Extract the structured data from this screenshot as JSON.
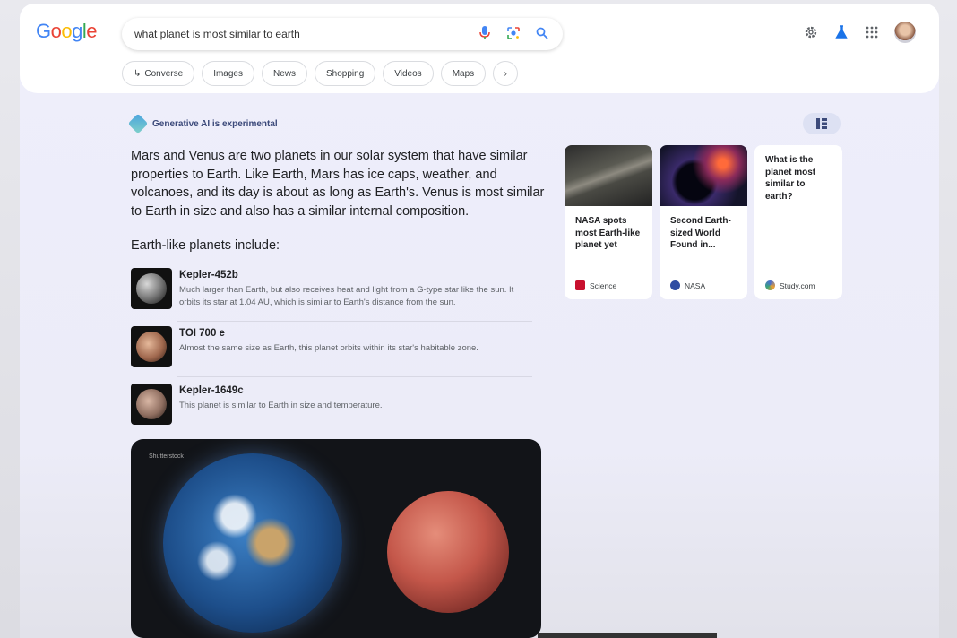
{
  "search": {
    "query": "what planet is most similar to earth"
  },
  "logo": {
    "text": "Google"
  },
  "chips": [
    {
      "label": "Converse",
      "icon": "converse-arrow-icon"
    },
    {
      "label": "Images"
    },
    {
      "label": "News"
    },
    {
      "label": "Shopping"
    },
    {
      "label": "Videos"
    },
    {
      "label": "Maps"
    }
  ],
  "ai": {
    "label": "Generative AI is experimental",
    "summary": "Mars and Venus are two planets in our solar system that have similar properties to Earth. Like Earth, Mars has ice caps, weather, and volcanoes, and its day is about as long as Earth's. Venus is most similar to Earth in size and also has a similar internal composition.",
    "subhead": "Earth-like planets include:",
    "planets": [
      {
        "name": "Kepler-452b",
        "desc": "Much larger than Earth, but also receives heat and light from a G-type star like the sun. It orbits its star at 1.04 AU, which is similar to Earth's distance from the sun."
      },
      {
        "name": "TOI 700 e",
        "desc": "Almost the same size as Earth, this planet orbits within its star's habitable zone."
      },
      {
        "name": "Kepler-1649c",
        "desc": "This planet is similar to Earth in size and temperature."
      }
    ],
    "hero_credit": "Shutterstock"
  },
  "cards": [
    {
      "title": "NASA spots most Earth-like planet yet",
      "source": "Science"
    },
    {
      "title": "Second Earth-sized World Found in...",
      "source": "NASA"
    },
    {
      "title": "What is the planet most similar to earth?",
      "source": "Study.com"
    }
  ],
  "colors": {
    "google_blue": "#4285F4",
    "google_red": "#EA4335",
    "google_yellow": "#FBBC05",
    "google_green": "#34A853",
    "science_red": "#c8102e",
    "nasa_blue": "#2f4da3"
  }
}
